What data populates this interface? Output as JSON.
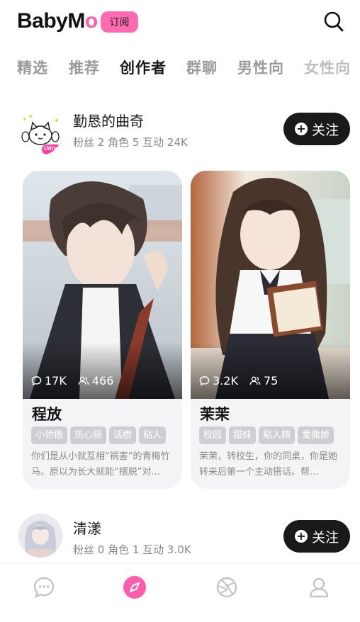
{
  "header": {
    "logo_main": "BabyM",
    "logo_tail": "o",
    "subscribe_label": "订阅",
    "accent_color": "#ff6bb0"
  },
  "tabs": [
    {
      "label": "精选",
      "active": false
    },
    {
      "label": "推荐",
      "active": false
    },
    {
      "label": "创作者",
      "active": true
    },
    {
      "label": "群聊",
      "active": false
    },
    {
      "label": "男性向",
      "active": false
    },
    {
      "label": "女性向",
      "active": false
    }
  ],
  "creators": [
    {
      "name": "勤恳的曲奇",
      "stats": "粉丝 2 角色 5 互动 24K",
      "badge": "Ultra",
      "follow_label": "关注",
      "cards": [
        {
          "title": "程放",
          "comments": "17K",
          "users": "466",
          "tags": [
            "小骄傲",
            "热心肠",
            "话痨",
            "粘人"
          ],
          "desc": "你们是从小就互相“祸害”的青梅竹马。原以为长大就能“摆脱”对..."
        },
        {
          "title": "茉茉",
          "comments": "3.2K",
          "users": "75",
          "tags": [
            "校园",
            "甜妹",
            "粘人精",
            "爱撒娇"
          ],
          "desc": "茉茉，转校生，你的同桌，你是她转来后第一个主动搭话、帮..."
        }
      ]
    },
    {
      "name": "清漾",
      "stats": "粉丝 0 角色 1 互动 3.0K",
      "follow_label": "关注"
    }
  ],
  "bottom_nav": [
    {
      "icon": "chat-bubble-icon",
      "active": false
    },
    {
      "icon": "compass-icon",
      "active": true
    },
    {
      "icon": "aperture-icon",
      "active": false
    },
    {
      "icon": "profile-icon",
      "active": false
    }
  ]
}
